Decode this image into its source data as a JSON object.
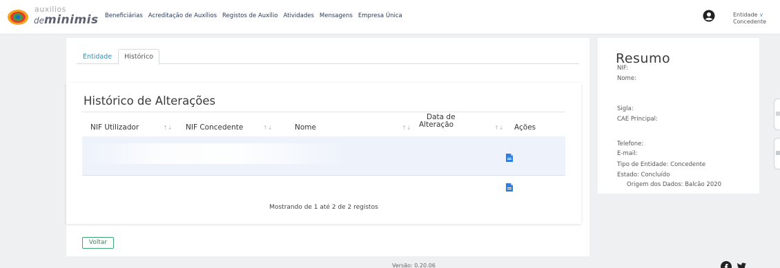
{
  "logo": {
    "top": "auxilios",
    "de": "de",
    "minimis": "minimis"
  },
  "nav": [
    "Beneficiárias",
    "Acreditação de Auxílios",
    "Registos de Auxílio",
    "Atividades",
    "Mensagens",
    "Empresa Única"
  ],
  "entity_dropdown": {
    "line1": "Entidade",
    "line2": "Concedente"
  },
  "tabs": [
    "Entidade",
    "Histórico"
  ],
  "history": {
    "title": "Histórico de Alterações",
    "columns": {
      "nif_utilizador": "NIF Utilizador",
      "nif_concedente": "NIF Concedente",
      "nome": "Nome",
      "data_line1": "Data de",
      "data_line2": "Alteração",
      "acoes": "Ações"
    },
    "footer": "Mostrando de 1 até 2 de 2 registos"
  },
  "back_button": "Voltar",
  "summary": {
    "title": "Resumo",
    "nif": "NIF:",
    "nome": "Nome:",
    "sigla": "Sigla:",
    "cae": "CAE Principal:",
    "telefone": "Telefone:",
    "email": "E-mail:",
    "tipo": "Tipo de Entidade: Concedente",
    "estado": "Estado: Concluído",
    "origem": "Origem dos Dados: Balcão 2020"
  },
  "footer": {
    "version": "Versão: 0.20.06"
  },
  "colors": {
    "link": "#2a8fb5",
    "accent_green": "#3ba66f",
    "row_highlight": "#eef3fb",
    "doc_icon": "#2f7de1"
  },
  "icons": [
    "logo-mark",
    "user-icon",
    "chevron-down-icon",
    "sort-icon",
    "document-icon",
    "facebook-icon",
    "twitter-icon"
  ]
}
